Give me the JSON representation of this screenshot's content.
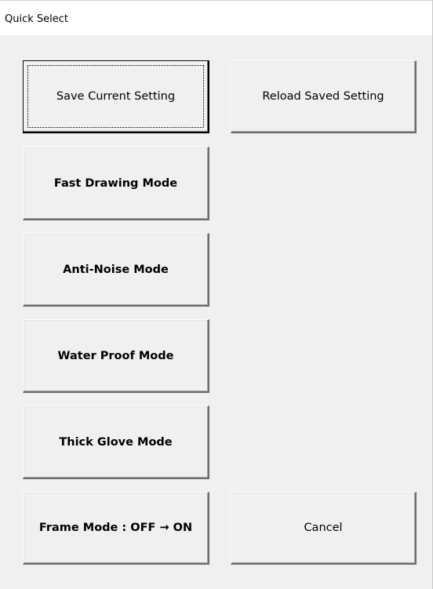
{
  "window": {
    "title": "Quick Select"
  },
  "buttons": {
    "save_current": "Save Current Setting",
    "reload_saved": "Reload Saved Setting",
    "fast_drawing": "Fast Drawing Mode",
    "anti_noise": "Anti-Noise Mode",
    "water_proof": "Water Proof Mode",
    "thick_glove": "Thick Glove Mode",
    "frame_mode": "Frame Mode : OFF → ON",
    "cancel": "Cancel"
  },
  "focused_button": "save_current"
}
